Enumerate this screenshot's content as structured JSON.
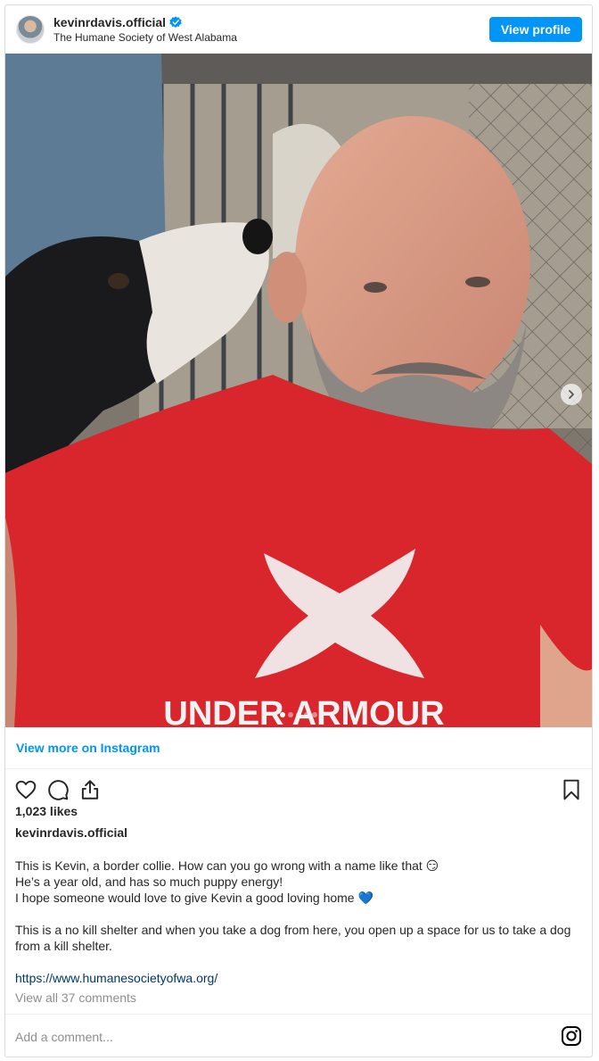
{
  "header": {
    "username": "kevinrdavis.official",
    "location": "The Humane Society of West Alabama",
    "view_profile_label": "View profile",
    "verified_icon": "verified-badge-icon",
    "accent": "#0095f6"
  },
  "media": {
    "shirt_text": "UNDER ARMOUR",
    "carousel_count": 5,
    "carousel_active": 1,
    "next_icon": "chevron-right-icon"
  },
  "view_more_label": "View more on Instagram",
  "actions": {
    "icons": [
      "heart-icon",
      "comment-icon",
      "share-icon",
      "bookmark-icon"
    ]
  },
  "likes": "1,023 likes",
  "caption": {
    "username": "kevinrdavis.official",
    "line1": "This is Kevin, a border collie. How can you go wrong with a name like that 😏",
    "line2": "He’s a year old, and has so much puppy energy!",
    "line3": "I hope someone would love to give Kevin a good loving home 💙",
    "paragraph2": "This is a no kill shelter and when you take a dog from here, you open up a space for us to take a dog from a kill shelter.",
    "link": "https://www.humanesocietyofwa.org/"
  },
  "comments_label": "View all 37 comments",
  "add_comment_placeholder": "Add a comment..."
}
